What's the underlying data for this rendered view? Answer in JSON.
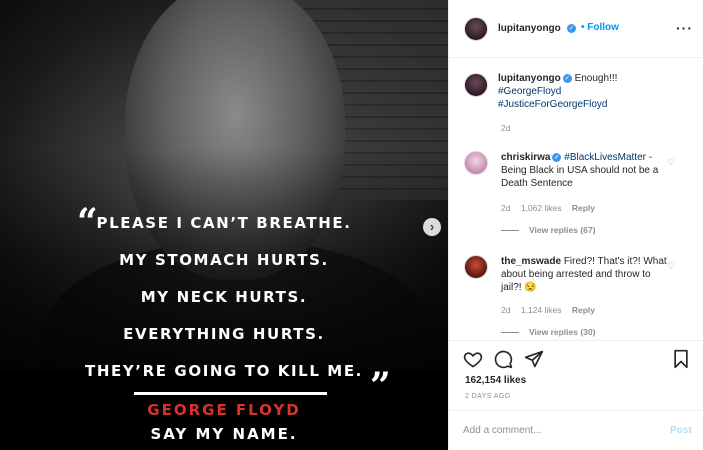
{
  "media": {
    "quote_lines": [
      "PLEASE I CAN’T BREATHE.",
      "MY STOMACH HURTS.",
      "MY NECK HURTS.",
      "EVERYTHING HURTS.",
      "THEY’RE GOING TO KILL ME."
    ],
    "open_quote": "“",
    "close_quote": "”",
    "author": "GEORGE FLOYD",
    "tagline": "SAY MY NAME.",
    "next_glyph": "›"
  },
  "header": {
    "username": "lupitanyongo",
    "verified_glyph": "✓",
    "follow_label": "• Follow",
    "more_glyph": "···"
  },
  "caption": {
    "username": "lupitanyongo",
    "text": "Enough!!!",
    "hashtags": [
      "#GeorgeFloyd",
      "#JusticeForGeorgeFloyd"
    ],
    "time": "2d"
  },
  "comments": [
    {
      "username": "chriskirwa",
      "hashtag": "#BlackLivesMatter",
      "text": "- Being Black in USA should not be a Death Sentence",
      "time": "2d",
      "likes": "1,062 likes",
      "reply": "Reply",
      "view_replies": "View replies (67)"
    },
    {
      "username": "the_mswade",
      "text": "Fired?! That's it?! What about being arrested and throw to jail?! 😒",
      "time": "2d",
      "likes": "1,124 likes",
      "reply": "Reply",
      "view_replies": "View replies (30)"
    }
  ],
  "actions": {
    "icons": [
      "heart-icon",
      "comment-icon",
      "share-icon",
      "bookmark-icon"
    ],
    "likes": "162,154 likes",
    "timestamp": "2 DAYS AGO"
  },
  "add_comment": {
    "placeholder": "Add a comment...",
    "post_label": "Post"
  },
  "colors": {
    "accent": "#0095f6",
    "author_red": "#d8322f",
    "muted": "#8e8e8e"
  }
}
